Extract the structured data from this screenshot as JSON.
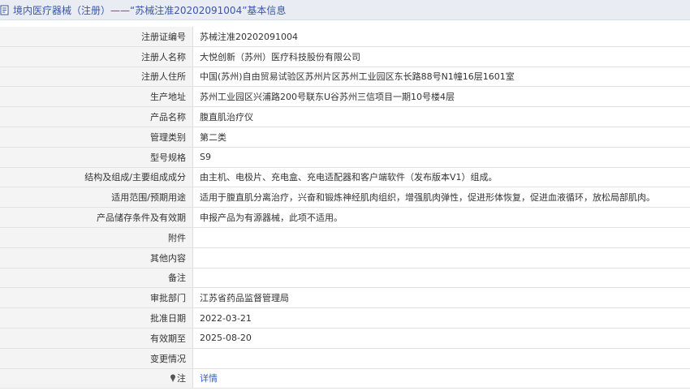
{
  "header": {
    "title": "境内医疗器械（注册）——“苏械注准20202091004”基本信息",
    "icon": "document-icon"
  },
  "rows": [
    {
      "label": "注册证编号",
      "value": "苏械注准20202091004"
    },
    {
      "label": "注册人名称",
      "value": "大悦创新（苏州）医疗科技股份有限公司"
    },
    {
      "label": "注册人住所",
      "value": "中国(苏州)自由贸易试验区苏州片区苏州工业园区东长路88号N1幢16层1601室"
    },
    {
      "label": "生产地址",
      "value": "苏州工业园区兴浦路200号联东U谷苏州三信项目一期10号楼4层"
    },
    {
      "label": "产品名称",
      "value": "腹直肌治疗仪"
    },
    {
      "label": "管理类别",
      "value": "第二类"
    },
    {
      "label": "型号规格",
      "value": "S9"
    },
    {
      "label": "结构及组成/主要组成成分",
      "value": "由主机、电极片、充电盒、充电适配器和客户端软件（发布版本V1）组成。"
    },
    {
      "label": "适用范围/预期用途",
      "value": "适用于腹直肌分离治疗，兴奋和锻炼神经肌肉组织，增强肌肉弹性，促进形体恢复，促进血液循环，放松局部肌肉。"
    },
    {
      "label": "产品储存条件及有效期",
      "value": "申报产品为有源器械，此项不适用。"
    },
    {
      "label": "附件",
      "value": ""
    },
    {
      "label": "其他内容",
      "value": ""
    },
    {
      "label": "备注",
      "value": ""
    },
    {
      "label": "审批部门",
      "value": "江苏省药品监督管理局"
    },
    {
      "label": "批准日期",
      "value": "2022-03-21"
    },
    {
      "label": "有效期至",
      "value": "2025-08-20"
    },
    {
      "label": "变更情况",
      "value": ""
    }
  ],
  "note": {
    "label": "注",
    "icon": "pin-icon",
    "link": "详情"
  }
}
